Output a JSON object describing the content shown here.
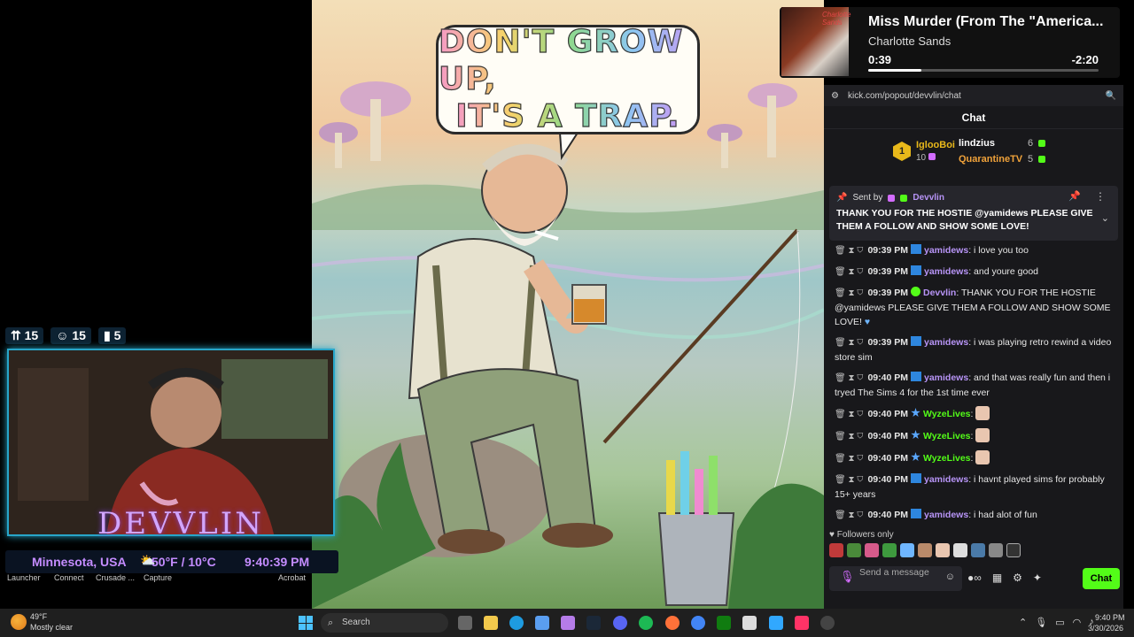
{
  "artwork": {
    "bubble_line1": "DON'T GROW UP,",
    "bubble_line2": "IT'S A TRAP."
  },
  "player": {
    "title": "Miss Murder (From The \"America...",
    "artist": "Charlotte Sands",
    "elapsed": "0:39",
    "remaining": "-2:20",
    "progress_fraction": 0.23,
    "album_tag": "Charlotte Sands"
  },
  "chat": {
    "url": "kick.com/popout/devvlin/chat",
    "header": "Chat",
    "leaderboard": {
      "first_rank": "1",
      "first_name": "IglooBoi",
      "first_count": "10",
      "rows": [
        {
          "name": "lindzius",
          "count": "6"
        },
        {
          "name": "QuarantineTV",
          "count": "5"
        }
      ]
    },
    "pinned": {
      "sent_by": "Sent by",
      "author": "Devvlin",
      "text": "THANK YOU FOR THE HOSTIE @yamidews PLEASE GIVE THEM A FOLLOW AND SHOW SOME LOVE!"
    },
    "messages": [
      {
        "time": "09:39 PM",
        "user": "yamidews",
        "text": ": i love you too"
      },
      {
        "time": "09:39 PM",
        "user": "yamidews",
        "text": ": and youre good"
      },
      {
        "time": "09:39 PM",
        "user": "Devvlin",
        "text": ": THANK YOU FOR THE HOSTIE @yamidews PLEASE GIVE THEM A FOLLOW AND SHOW SOME LOVE!"
      },
      {
        "time": "09:39 PM",
        "user": "yamidews",
        "text": ": i was playing retro rewind a video store sim"
      },
      {
        "time": "09:40 PM",
        "user": "yamidews",
        "text": ": and that was really fun and then i tryed The Sims 4 for the 1st time ever"
      },
      {
        "time": "09:40 PM",
        "user": "WyzeLives",
        "text": ":"
      },
      {
        "time": "09:40 PM",
        "user": "WyzeLives",
        "text": ":"
      },
      {
        "time": "09:40 PM",
        "user": "WyzeLives",
        "text": ":"
      },
      {
        "time": "09:40 PM",
        "user": "yamidews",
        "text": ": i havnt played sims for probably 15+ years"
      },
      {
        "time": "09:40 PM",
        "user": "yamidews",
        "text": ": i had alot of fun"
      }
    ],
    "followers_only": "Followers only",
    "input_placeholder": "Send a message",
    "send_label": "Chat"
  },
  "overlay": {
    "stat1": "15",
    "stat2": "15",
    "stat3": "5",
    "streamer_name": "DEVVLIN",
    "location": "Minnesota, USA",
    "weather": "50°F / 10°C",
    "time": "9:40:39 PM",
    "dock_labels": [
      "Launcher",
      "Connect",
      "Crusade ...",
      "Capture",
      "Acrobat"
    ]
  },
  "taskbar": {
    "temp": "49°F",
    "condition": "Mostly clear",
    "search": "Search",
    "time": "9:40 PM",
    "date": "3/30/2026"
  },
  "colors": {
    "kick_green": "#53fc18",
    "chat_bg": "#18181b",
    "username_purple": "#b794f6",
    "overlay_purple": "#c48cff",
    "cam_border": "#28a6c9"
  }
}
